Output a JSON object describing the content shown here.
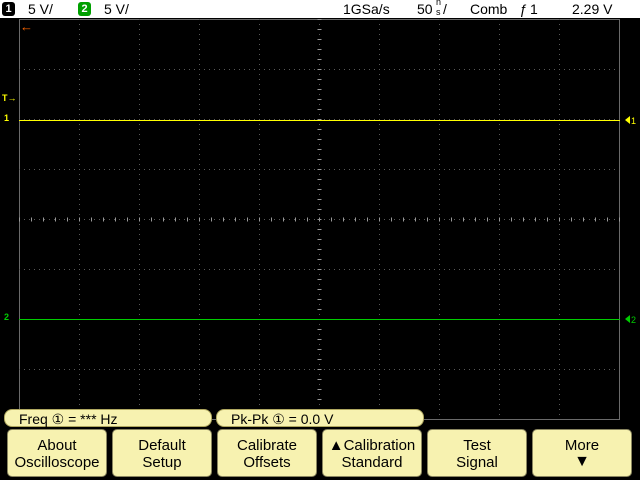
{
  "status_bar": {
    "ch1_badge": "1",
    "ch1_scale": "5 V/",
    "ch2_badge": "2",
    "ch2_scale": "5 V/",
    "sample_rate": "1GSa/s",
    "timebase_value": "50",
    "timebase_unit_top": "n",
    "timebase_unit_bottom": "s",
    "timebase_suffix": "/",
    "acq_mode": "Comb",
    "trigger_symbol": "ƒ",
    "trigger_source": "1",
    "trigger_level": "2.29 V"
  },
  "display": {
    "trigger_time_marker": "←",
    "trigger_level_marker": "T→",
    "ch1_marker_left": "1",
    "ch2_marker_left": "2"
  },
  "measurements": {
    "freq": "Freq ① = *** Hz",
    "pkpk": "Pk-Pk ① = 0.0 V"
  },
  "softkeys": [
    {
      "line1": "About",
      "line2": "Oscilloscope"
    },
    {
      "line1": "Default",
      "line2": "Setup"
    },
    {
      "line1": "Calibrate",
      "line2": "Offsets"
    },
    {
      "line1": "▲Calibration",
      "line2": "Standard"
    },
    {
      "line1": "Test",
      "line2": "Signal"
    },
    {
      "line1": "More",
      "line2": "▼"
    }
  ],
  "colors": {
    "ch1": "#ffff00",
    "ch2": "#00cc00",
    "trigger": "#ff6600",
    "softkey_bg": "#f7f2b0"
  }
}
